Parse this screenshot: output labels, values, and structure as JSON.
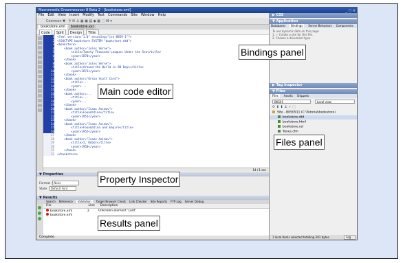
{
  "app": {
    "title": "Macromedia Dreamweaver 8 Beta 2 - [bookstore.xml]",
    "window_controls": "_ □ ×"
  },
  "menu": [
    "File",
    "Edit",
    "View",
    "Insert",
    "Modify",
    "Text",
    "Commands",
    "Site",
    "Window",
    "Help"
  ],
  "toolbar": {
    "label": "Common ▼"
  },
  "doc_tabs": [
    "bookstore.xml",
    "bookstore.xsl"
  ],
  "view_buttons": [
    "Code",
    "Split",
    "Design",
    "Title:"
  ],
  "code_lines": [
    {
      "n": "1",
      "text": "<?xml version=\"1.0\" encoding=\"iso-8859-1\"?>"
    },
    {
      "n": "2",
      "text": "<!DOCTYPE bookstore SYSTEM \"bookstore.dtd\">"
    },
    {
      "n": "3",
      "text": "<bookstore>"
    },
    {
      "n": "4",
      "text": "    <book author=\"Jules Verne\">"
    },
    {
      "n": "5",
      "text": "        <title>Twenty Thousand Leagues Under the Sea</title>"
    },
    {
      "n": "6",
      "text": "        <year>1870</year>"
    },
    {
      "n": "7",
      "text": "    </book>"
    },
    {
      "n": "8",
      "text": "    <book author=\"Jules Verne\">"
    },
    {
      "n": "9",
      "text": "        <title>Around the World in 80 Days</title>"
    },
    {
      "n": "10",
      "text": "        <year>1873</year>"
    },
    {
      "n": "11",
      "text": "    </book>"
    },
    {
      "n": "12",
      "text": "    <book author=\"Orson Scott Card\">"
    },
    {
      "n": "13",
      "text": "        <title>..."
    },
    {
      "n": "14",
      "text": "        <year>..."
    },
    {
      "n": "15",
      "text": "    </book>"
    },
    {
      "n": "16",
      "text": "    <book author=..."
    },
    {
      "n": "17",
      "text": "        <title>..."
    },
    {
      "n": "18",
      "text": "        <year>..."
    },
    {
      "n": "19",
      "text": "    </book>"
    },
    {
      "n": "20",
      "text": "    <book author=\"Isaac Asimov\">"
    },
    {
      "n": "21",
      "text": "        <title>Foundation</title>"
    },
    {
      "n": "22",
      "text": "        <year>1951</year>"
    },
    {
      "n": "23",
      "text": "    </book>"
    },
    {
      "n": "24",
      "text": "    <book author=\"Isaac Asimov\">"
    },
    {
      "n": "25",
      "text": "        <title>Foundation and Empire</title>"
    },
    {
      "n": "26",
      "text": "        <year>1952</year>"
    },
    {
      "n": "27",
      "text": "    </book>"
    },
    {
      "n": "28",
      "text": "    <book author=\"Isaac Asimov\">"
    },
    {
      "n": "29",
      "text": "        <title>I, Robot</title>"
    },
    {
      "n": "30",
      "text": "        <year>1950</year>"
    },
    {
      "n": "31",
      "text": "    </book>"
    },
    {
      "n": "32",
      "text": "</bookstore>"
    }
  ],
  "code_status": "14 / 1 sec",
  "properties": {
    "header": "▼ Properties",
    "format_label": "Format",
    "format_value": "None",
    "style_label": "Style",
    "style_value": "Default Font"
  },
  "results": {
    "header": "▼ Results",
    "tabs": [
      "Search",
      "Reference",
      "Validation",
      "Target Browser Check",
      "Link Checker",
      "Site Reports",
      "FTP Log",
      "Server Debug"
    ],
    "active_tab": "Validation",
    "columns": [
      "File",
      "Line",
      "Description"
    ],
    "rows": [
      {
        "file": "bookstore.xml",
        "line": "2",
        "desc": "Unknown element 'card'"
      },
      {
        "file": "bookstore.xml",
        "line": "",
        "desc": ""
      }
    ],
    "status": "Complete."
  },
  "right_panel": {
    "css_header": "▶ CSS",
    "application_header": "▼ Application",
    "app_tabs": [
      "Databases",
      "Bindings",
      "Server Behaviors",
      "Components"
    ],
    "app_active_tab": "Bindings",
    "bindings_text": [
      "To use dynamic data on this page:",
      "1. ✓ Create a site for this file.",
      "2. Choose a document type."
    ],
    "tag_inspector_header": "▶ Tag Inspector",
    "files_header": "▼ Files",
    "files_tabs": [
      "Files",
      "Assets",
      "Snippets"
    ],
    "site_select": "BKS01",
    "view_select": "Local view",
    "files": [
      {
        "name": "Site - BKS0911 (C:\\Tutorial\\bookstore)",
        "selected": false
      },
      {
        "name": "bookstore.dtd",
        "selected": true
      },
      {
        "name": "bookstore.html",
        "selected": false
      },
      {
        "name": "bookstore.xsl",
        "selected": false
      },
      {
        "name": "Tunes.cfm",
        "selected": false
      },
      {
        "name": "cms.xml",
        "selected": false
      }
    ],
    "status": "1 local items selected totalling 203 bytes.",
    "log_button": "Log..."
  },
  "callouts": {
    "bindings": "Bindings panel",
    "code_editor": "Main code editor",
    "files": "Files panel",
    "property_inspector": "Property Inspector",
    "results": "Results panel"
  }
}
